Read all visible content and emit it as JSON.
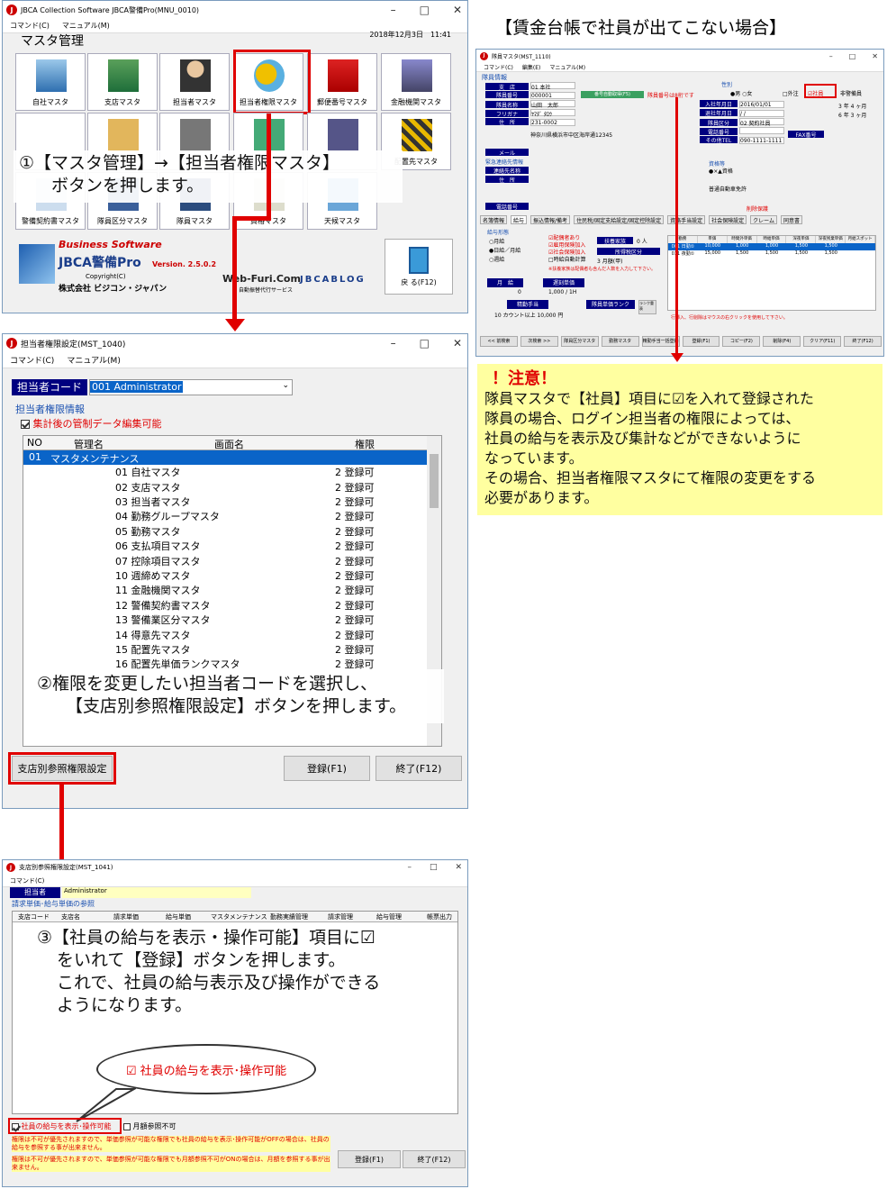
{
  "window1": {
    "title": "JBCA Collection Software JBCA警備Pro(MNU_0010)",
    "menu": [
      "コマンド(C)",
      "マニュアル(M)"
    ],
    "heading": "マスタ管理",
    "datetime": "2018年12月3日　11:41",
    "tiles_row1": [
      "自社マスタ",
      "支店マスタ",
      "担当者マスタ",
      "担当者権限マスタ",
      "郵便番号マスタ",
      "金融機関マスタ"
    ],
    "tiles_row2_partial": [
      "税",
      "",
      "",
      "",
      "",
      "配置先マスタ"
    ],
    "tiles_row3": [
      "警備契約書マスタ",
      "隊員区分マスタ",
      "隊員マスタ",
      "資格マスタ",
      "天候マスタ"
    ],
    "brand_top": "Business Software",
    "brand_name": "JBCA警備Pro",
    "version": "Version. 2.5.0.2",
    "copyright": "Copyright(C)",
    "company": "株式会社 ビジコン・ジャパン",
    "web": "Web-Furi.Com",
    "web_sub": "自動振替代行サービス",
    "blog": "JBCABLOG",
    "back_button": "戻 る(F12)"
  },
  "step1": {
    "line1": "①【マスタ管理】→【担当者権限マスタ】",
    "line2": "ボタンを押します。"
  },
  "window2": {
    "title": "担当者権限設定(MST_1040)",
    "menu": [
      "コマンド(C)",
      "マニュアル(M)"
    ],
    "code_label": "担当者コード",
    "code_value": "001  Administrator",
    "section": "担当者権限情報",
    "check_label": "集計後の管制データ編集可能",
    "columns": [
      "NO",
      "管理名",
      "画面名",
      "権限"
    ],
    "group_no": "01",
    "group_name": "マスタメンテナンス",
    "rows": [
      {
        "name": "01 自社マスタ",
        "perm": "2 登録可"
      },
      {
        "name": "02 支店マスタ",
        "perm": "2 登録可"
      },
      {
        "name": "03 担当者マスタ",
        "perm": "2 登録可"
      },
      {
        "name": "04 勤務グループマスタ",
        "perm": "2 登録可"
      },
      {
        "name": "05 勤務マスタ",
        "perm": "2 登録可"
      },
      {
        "name": "06 支払項目マスタ",
        "perm": "2 登録可"
      },
      {
        "name": "07 控除項目マスタ",
        "perm": "2 登録可"
      },
      {
        "name": "10 週締めマスタ",
        "perm": "2 登録可"
      },
      {
        "name": "11 金融機関マスタ",
        "perm": "2 登録可"
      },
      {
        "name": "12 警備契約書マスタ",
        "perm": "2 登録可"
      },
      {
        "name": "13 警備業区分マスタ",
        "perm": "2 登録可"
      },
      {
        "name": "14 得意先マスタ",
        "perm": "2 登録可"
      },
      {
        "name": "15 配置先マスタ",
        "perm": "2 登録可"
      },
      {
        "name": "16 配置先単価ランクマスタ",
        "perm": "2 登録可"
      }
    ],
    "btn_branch": "支店別参照権限設定",
    "btn_register": "登録(F1)",
    "btn_exit": "終了(F12)"
  },
  "step2": {
    "line1": "②権限を変更したい担当者コードを選択し、",
    "line2": "【支店別参照権限設定】ボタンを押します。"
  },
  "window3": {
    "title": "支店別参照権限設定(MST_1041)",
    "menu": [
      "コマンド(C)"
    ],
    "tanto_label": "担当者",
    "tanto_value": "Administrator",
    "section": "請求単価･給与単価の参照",
    "columns": [
      "支店コード",
      "支店名",
      "請求単価",
      "給与単価",
      "マスタメンテナンス",
      "勤務実績管理",
      "請求管理",
      "給与管理",
      "帳票出力"
    ],
    "check1": "社員の給与を表示･操作可能",
    "check2": "月額参照不可",
    "note1": "権限は不可が優先されますので、単価参照が可能な権限でも社員の給与を表示･操作可能がOFFの場合は、社員の給与を参照する事が出来ません。",
    "note2": "権限は不可が優先されますので、単価参照が可能な権限でも月額参照不可がONの場合は、月額を参照する事が出来ません。",
    "btn_register": "登録(F1)",
    "btn_exit": "終了(F12)"
  },
  "step3": {
    "line1": "③【社員の給与を表示・操作可能】項目に☑",
    "line2": "をいれて【登録】ボタンを押します。",
    "line3": "これで、社員の給与表示及び操作ができる",
    "line4": "ようになります。"
  },
  "bubble": "☑ 社員の給与を表示･操作可能",
  "right": {
    "heading": "【賃金台帳で社員が出てこない場合】",
    "win_title": "隊員マスタ(MST_1110)",
    "menu": [
      "コマンド(C)",
      "編集(E)",
      "マニュアル(M)"
    ],
    "section": "隊員情報",
    "fields": [
      {
        "label": "支　店",
        "value": "01 本社"
      },
      {
        "label": "隊員番号",
        "value": "000001"
      },
      {
        "label": "隊員名称",
        "value": "山田　太郎"
      },
      {
        "label": "フリガナ",
        "value": "ﾔﾏﾀﾞ ﾀﾛｳ"
      },
      {
        "label": "住　所",
        "value": "231-0002"
      }
    ],
    "address": "神奈川県横浜市中区海岸通12345",
    "auto_btn": "番号自動取得(F5)",
    "auto_note": "隊員番号は8桁です",
    "gender_label": "性別",
    "gender_value": "●男 ○女",
    "shain": "☑社員",
    "gaichu": "□外注",
    "hijokin": "非警備員",
    "right_fields": [
      {
        "label": "入社年月日",
        "value": "2016/01/01"
      },
      {
        "label": "退社年月日",
        "value": "/  /"
      },
      {
        "label": "隊員区分",
        "value": "02 契約社員"
      },
      {
        "label": "電話番号",
        "value": ""
      },
      {
        "label": "その他TEL",
        "value": "090-1111-1111"
      }
    ],
    "tenure": "3 年  4 ヶ月",
    "tenure2": "6 年  3 ヶ月",
    "fax": "FAX番号",
    "mail": "メール",
    "emergency": "緊急連絡先情報",
    "contact_name": "連絡先名称",
    "contact_addr": "住　所",
    "tel": "電話番号",
    "qual_label": "資格等",
    "qual_value": "●×▲資格",
    "license": "普通自動車免許",
    "delete_chk": "削除保護",
    "tabs": [
      "名簿情報",
      "給与",
      "振込情報/備考",
      "住民税/固定支給設定/固定控除設定",
      "資格手当設定",
      "社会保険設定",
      "クレーム",
      "同意書"
    ],
    "pay_form": "給与形態",
    "pay_opts": [
      "○月給",
      "●日給／月給",
      "○週給"
    ],
    "insurance": [
      "☑配偶者あり",
      "☑雇用保険加入",
      "☑社会保険加入",
      "□時給自動計算"
    ],
    "dependents": "扶養家族",
    "dep_value": "0 人",
    "tax_class": "所得税区分",
    "tax_value": "3 月額(甲)",
    "note_red": "※扶養家族は配偶者も含んだ人数を入力して下さい。",
    "monthly": "月　給",
    "monthly_val": "0",
    "overtime": "遅刻単価",
    "overtime_val": "1,000 / 1H",
    "commute": "精勤手当",
    "commute_val": "10 カウント以上   10,000 円",
    "rank": "隊員単価ランク",
    "rank_btn": "ランク重表",
    "grid_head": [
      "勤務",
      "単価",
      "時間外単価",
      "時給単価",
      "深夜単価",
      "深夜残業単価",
      "月給スポット"
    ],
    "grid_rows": [
      [
        "001 日勤①",
        "10,000",
        "1,000",
        "1,000",
        "1,500",
        "1,500"
      ],
      [
        "011 夜勤①",
        "15,000",
        "1,500",
        "1,500",
        "1,500",
        "1,500"
      ]
    ],
    "grid_note": "行挿入、行削除はマウスの右クリックを使用して下さい。",
    "bottom_btns": [
      "<< 前検索",
      "次検索 >>",
      "隊員区分マスタ",
      "勤務マスタ",
      "精勤手当一括登録",
      "登録(F1)",
      "コピー(F2)",
      "削除(F4)",
      "クリア(F11)",
      "終了(F12)"
    ],
    "caution_title": "！注意！",
    "caution_lines": [
      "隊員マスタで【社員】項目に☑を入れて登録された",
      "隊員の場合、ログイン担当者の権限によっては、",
      "社員の給与を表示及び集計などができないように",
      "なっています。",
      "その場合、担当者権限マスタにて権限の変更をする",
      "必要があります。"
    ]
  },
  "colors": {
    "accent_red": "#e00000",
    "navy": "#000080",
    "note_yellow": "#ffffa0"
  }
}
